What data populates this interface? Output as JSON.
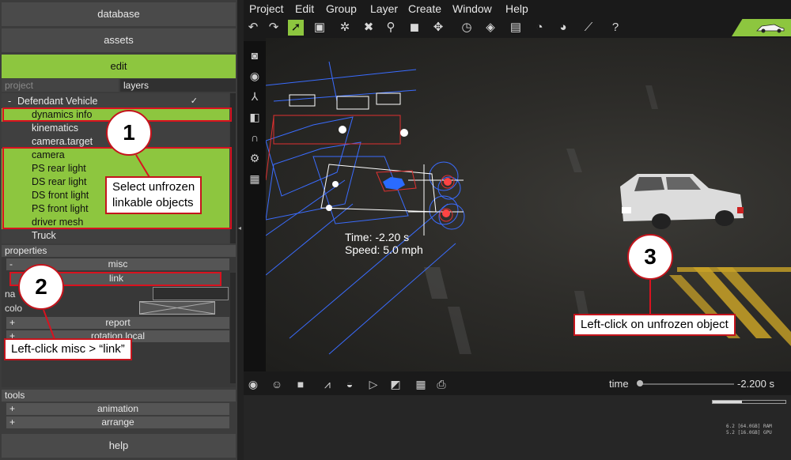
{
  "left_panel": {
    "top_buttons": [
      {
        "label": "database"
      },
      {
        "label": "assets"
      },
      {
        "label": "edit"
      }
    ],
    "tabs": {
      "project": "project",
      "layers": "layers"
    },
    "tree": {
      "root": {
        "label": "Defendant Vehicle",
        "expander": "-",
        "check": "✓"
      },
      "items": [
        {
          "label": "dynamics info",
          "selected": true
        },
        {
          "label": "kinematics",
          "selected": false
        },
        {
          "label": "camera.target",
          "selected": false
        },
        {
          "label": "camera",
          "selected": true
        },
        {
          "label": "PS rear light",
          "selected": true
        },
        {
          "label": "DS rear light",
          "selected": true
        },
        {
          "label": "DS front light",
          "selected": true
        },
        {
          "label": "PS front light",
          "selected": true
        },
        {
          "label": "driver mesh",
          "selected": true
        },
        {
          "label": "Truck",
          "selected": false
        }
      ]
    },
    "properties": {
      "header": "properties",
      "misc": {
        "expander": "-",
        "label": "misc"
      },
      "link": {
        "label": "link"
      },
      "name_label": "na",
      "color_label": "colo",
      "report": {
        "expander": "+",
        "label": "report"
      },
      "rotation": {
        "expander": "+",
        "label": "rotation.local"
      }
    },
    "tools": {
      "header": "tools",
      "animation": {
        "expander": "+",
        "label": "animation"
      },
      "arrange": {
        "expander": "+",
        "label": "arrange"
      }
    },
    "help_label": "help"
  },
  "menubar": [
    "Project",
    "Edit",
    "Group",
    "Layer",
    "Create",
    "Window",
    "Help"
  ],
  "viewport": {
    "time_readout": "Time: -2.20 s",
    "speed_readout": "Speed: 5.0 mph"
  },
  "bottom_bar": {
    "time_label": "time",
    "time_value": "-2.200 s",
    "memory_fraction": 0.4,
    "ram_text": "6.2 [64.0GB] RAM",
    "gpu_text": "5.2 [16.0GB] GPU"
  },
  "annotations": [
    {
      "number": "1",
      "text_line1": "Select unfrozen",
      "text_line2": "linkable objects"
    },
    {
      "number": "2",
      "text": "Left-click misc > “link”"
    },
    {
      "number": "3",
      "text": "Left-click on unfrozen object"
    }
  ],
  "colors": {
    "accent_green": "#8dc63f",
    "annotation_red": "#d9121f"
  }
}
